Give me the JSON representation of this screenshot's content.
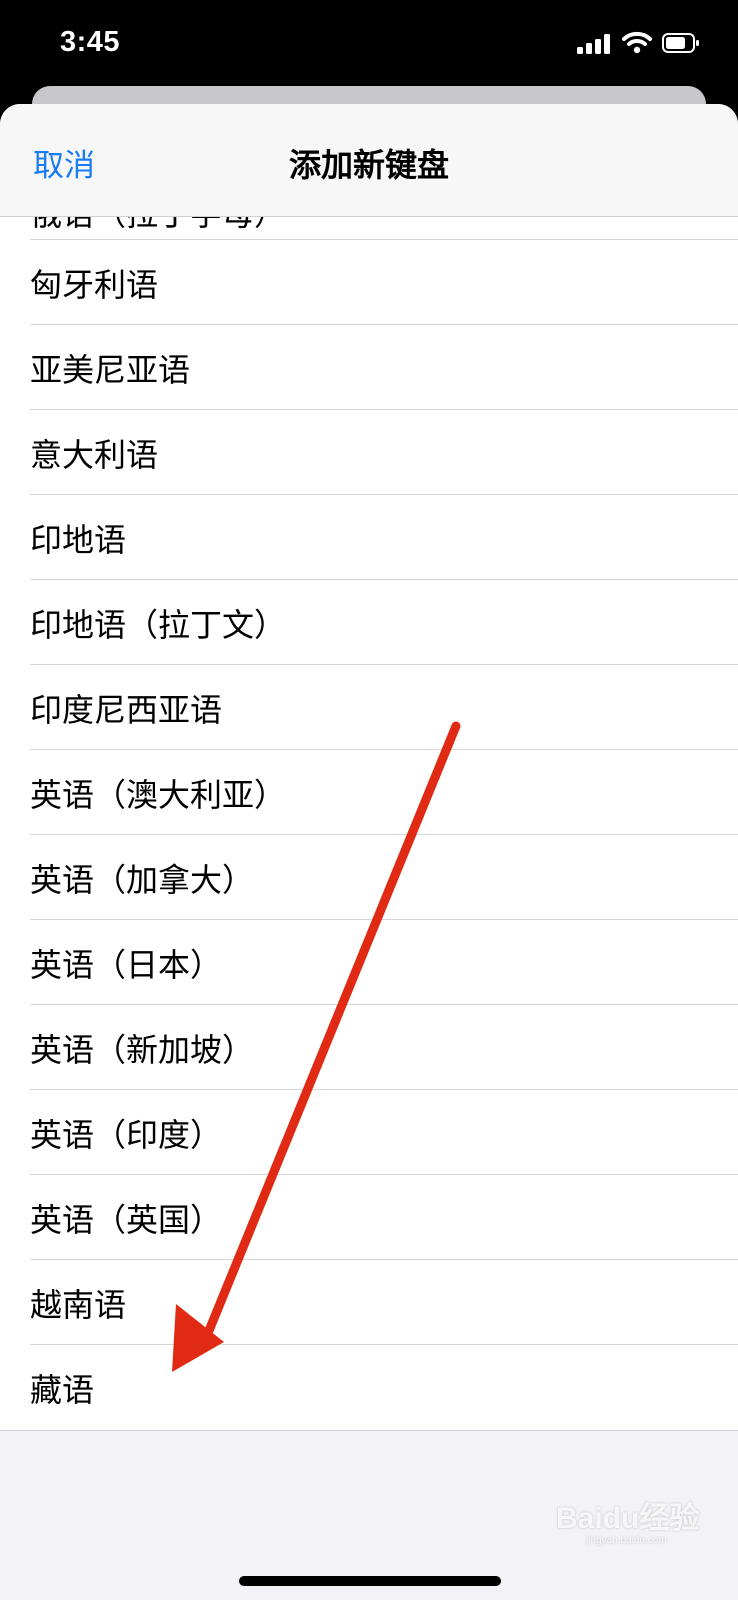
{
  "status_bar": {
    "time": "3:45",
    "icons": [
      "cellular-signal-icon",
      "wifi-icon",
      "battery-icon"
    ]
  },
  "nav": {
    "cancel_label": "取消",
    "title": "添加新键盘"
  },
  "list": {
    "partial_top_item": "俄语（拉丁字母）",
    "items": [
      "匈牙利语",
      "亚美尼亚语",
      "意大利语",
      "印地语",
      "印地语（拉丁文）",
      "印度尼西亚语",
      "英语（澳大利亚）",
      "英语（加拿大）",
      "英语（日本）",
      "英语（新加坡）",
      "英语（印度）",
      "英语（英国）",
      "越南语",
      "藏语"
    ]
  },
  "annotation": {
    "arrow_color": "#e02a14"
  },
  "watermark": {
    "text": "Baidu经验",
    "url": "jingyan.baidu.com"
  },
  "colors": {
    "accent": "#1a7cf5",
    "sheet_background": "#f2f2f7"
  }
}
